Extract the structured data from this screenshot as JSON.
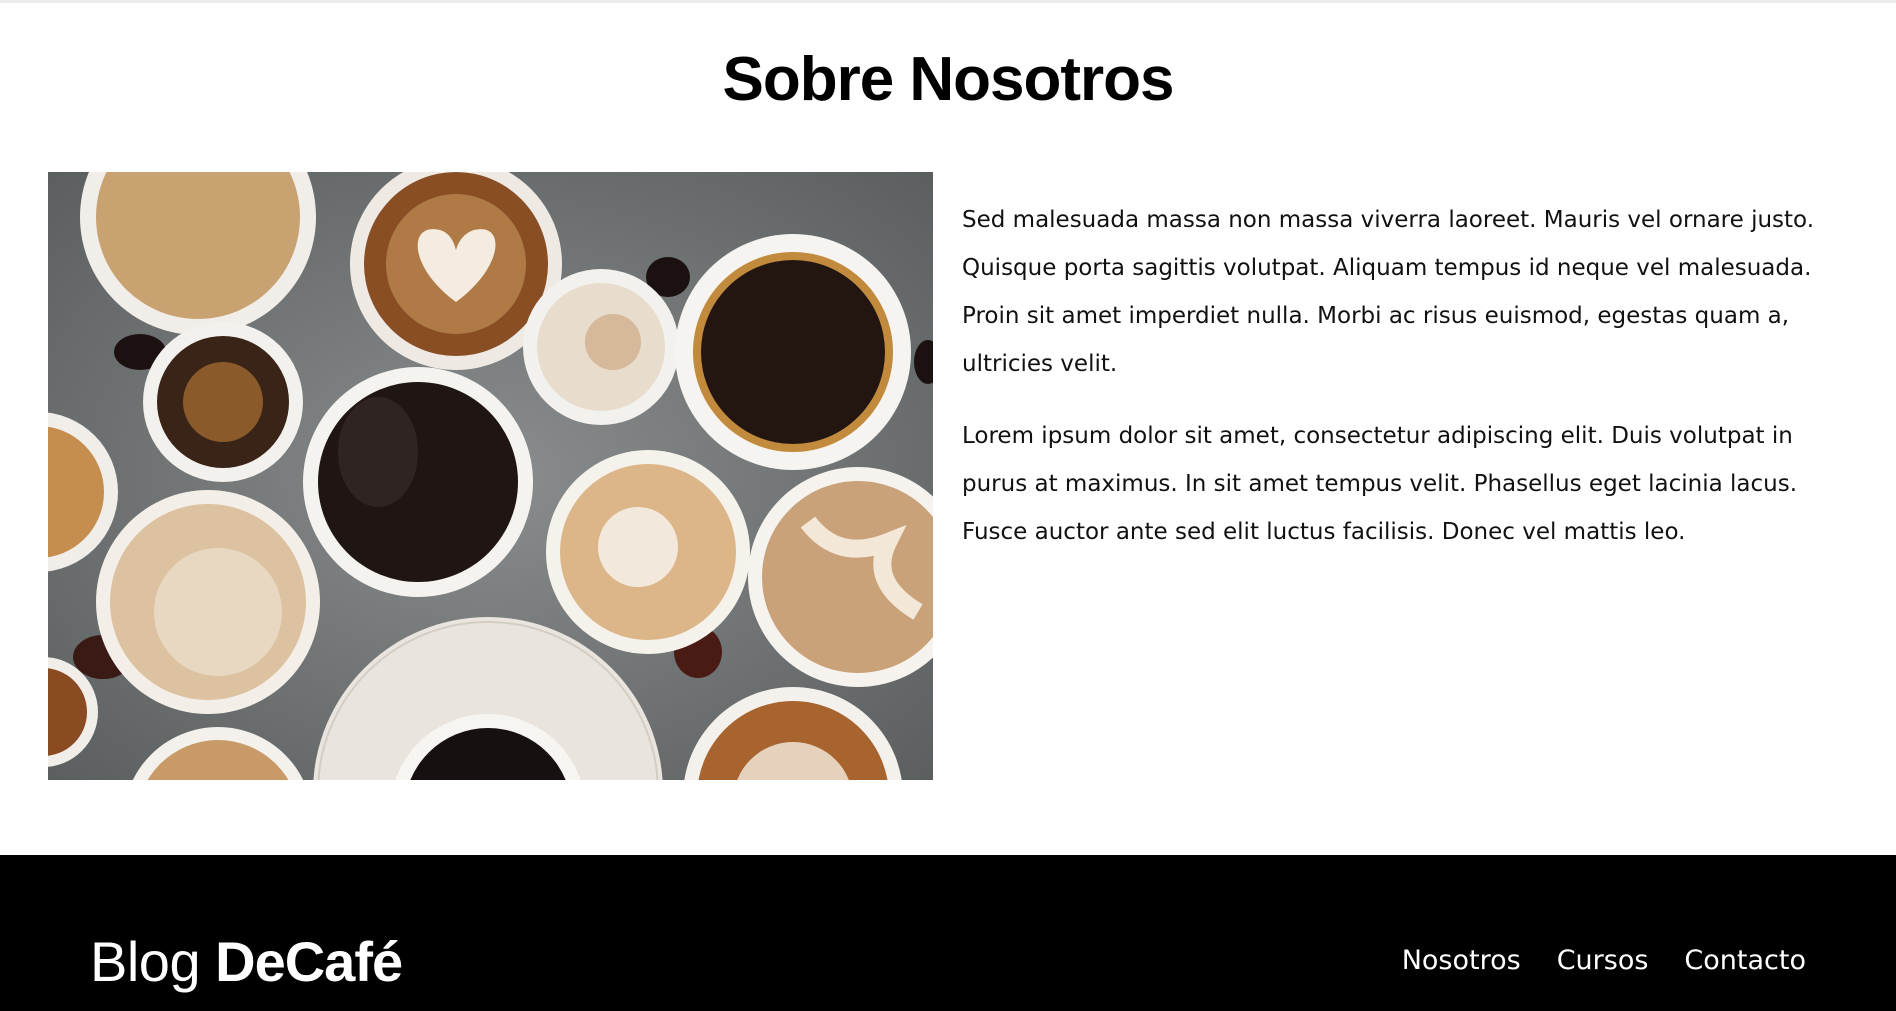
{
  "page": {
    "title": "Sobre Nosotros",
    "image_alt": "Tazas de café vistas desde arriba",
    "paragraphs": [
      "Sed malesuada massa non massa viverra laoreet. Mauris vel ornare justo. Quisque porta sagittis volutpat. Aliquam tempus id neque vel malesuada. Proin sit amet imperdiet nulla. Morbi ac risus euismod, egestas quam a, ultricies velit.",
      "Lorem ipsum dolor sit amet, consectetur adipiscing elit. Duis volutpat in purus at maximus. In sit amet tempus velit. Phasellus eget lacinia lacus. Fusce auctor ante sed elit luctus facilisis. Donec vel mattis leo."
    ]
  },
  "footer": {
    "logo_light": "Blog ",
    "logo_bold": "DeCafé",
    "nav": [
      "Nosotros",
      "Cursos",
      "Contacto"
    ]
  },
  "colors": {
    "background": "#ffffff",
    "footer_bg": "#000000",
    "footer_text": "#ffffff",
    "text": "#111111"
  }
}
